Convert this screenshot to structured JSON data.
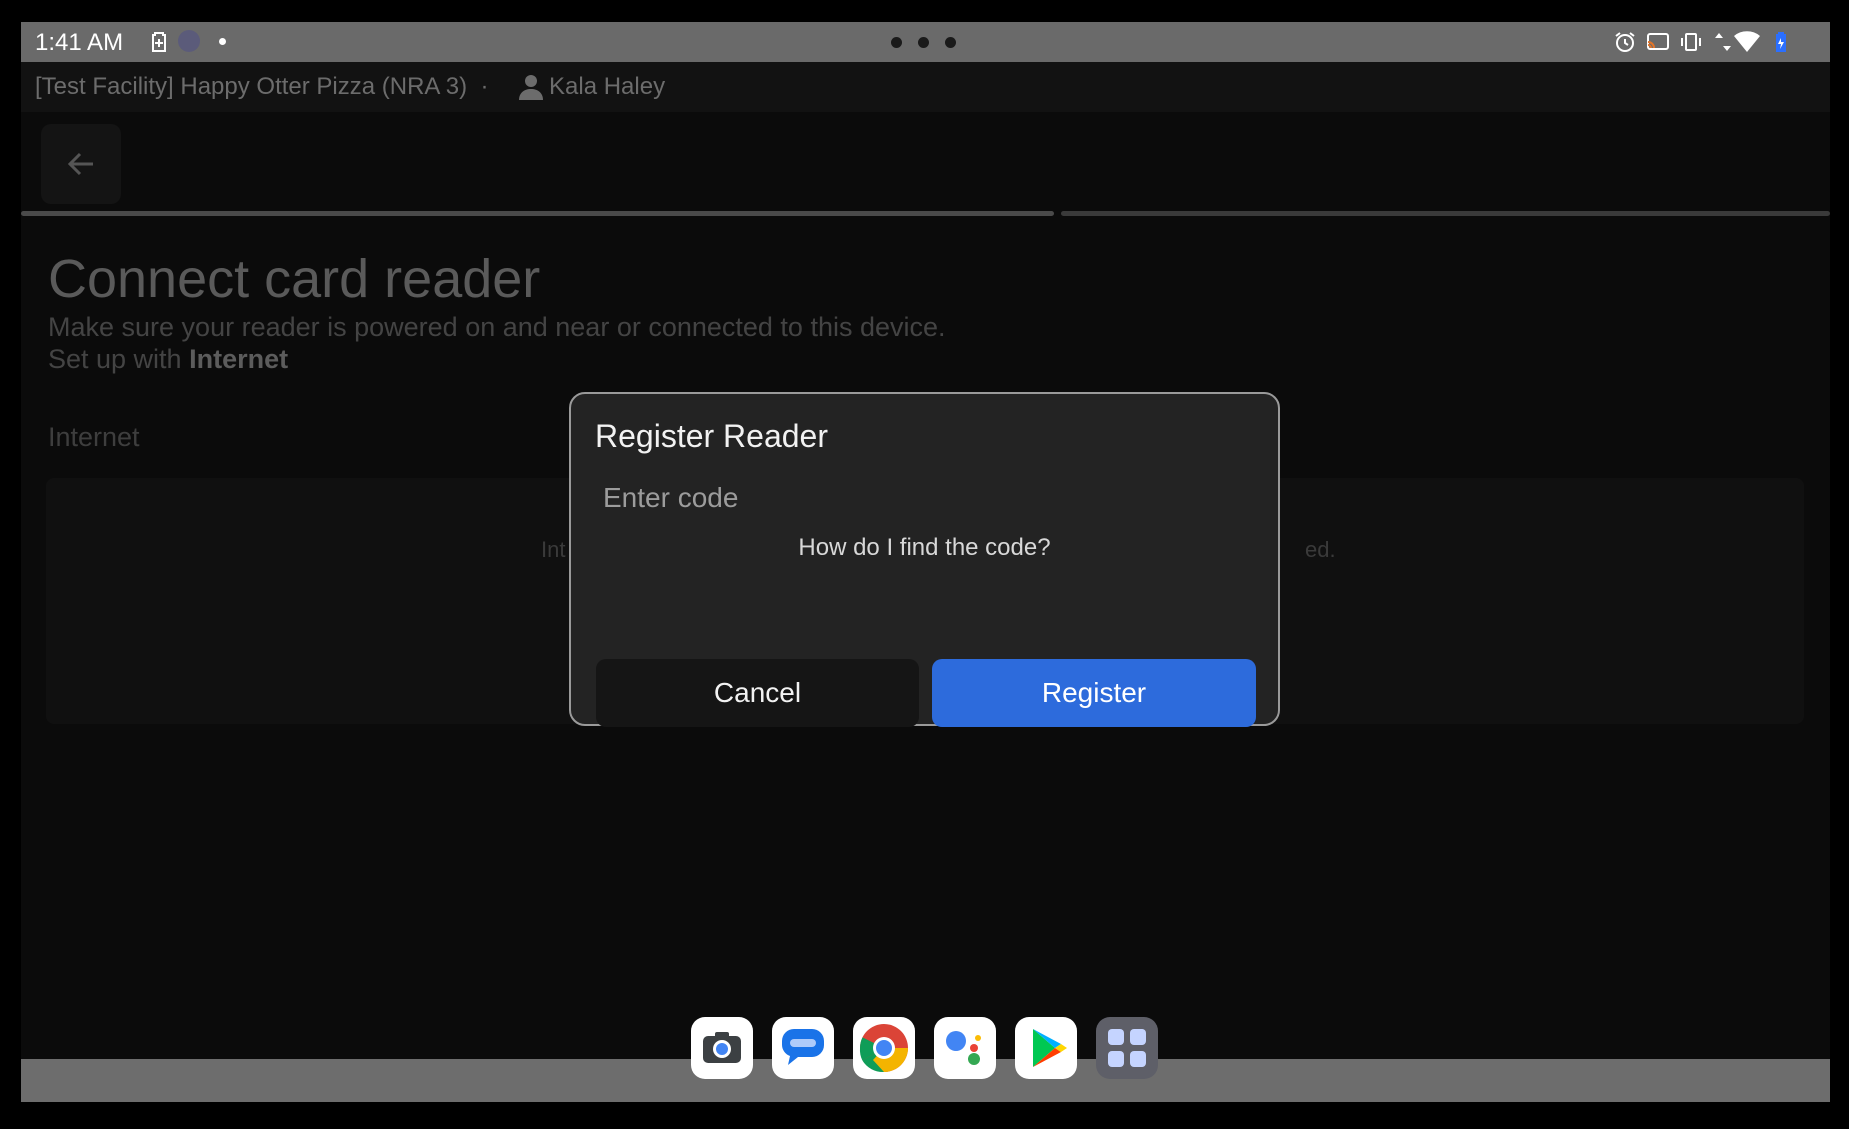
{
  "status_bar": {
    "time": "1:41 AM",
    "icons": [
      "battery-saver-icon",
      "notification-dot-icon",
      "alarm-icon",
      "cast-icon",
      "vibrate-icon",
      "data-arrows-icon",
      "wifi-icon",
      "battery-icon"
    ]
  },
  "header": {
    "facility": "[Test Facility] Happy Otter Pizza (NRA 3)",
    "separator": "·",
    "user_name": "Kala Haley"
  },
  "page": {
    "title": "Connect card reader",
    "subtitle": "Make sure your reader is powered on and near or connected to this device.",
    "setup_prefix": "Set up with",
    "setup_method": "Internet",
    "section_label": "Internet",
    "panel_text_left": "Int",
    "panel_text_right": "ed."
  },
  "dialog": {
    "title": "Register Reader",
    "input_placeholder": "Enter code",
    "input_value": "",
    "help_link": "How do I find the code?",
    "cancel_label": "Cancel",
    "register_label": "Register"
  },
  "dock": {
    "apps": [
      "camera-app-icon",
      "messages-app-icon",
      "chrome-app-icon",
      "assistant-app-icon",
      "play-store-app-icon",
      "app-drawer-icon"
    ]
  },
  "colors": {
    "primary_button": "#2d6bdc",
    "dialog_background": "#232323",
    "status_bar": "#6a6a6a"
  }
}
